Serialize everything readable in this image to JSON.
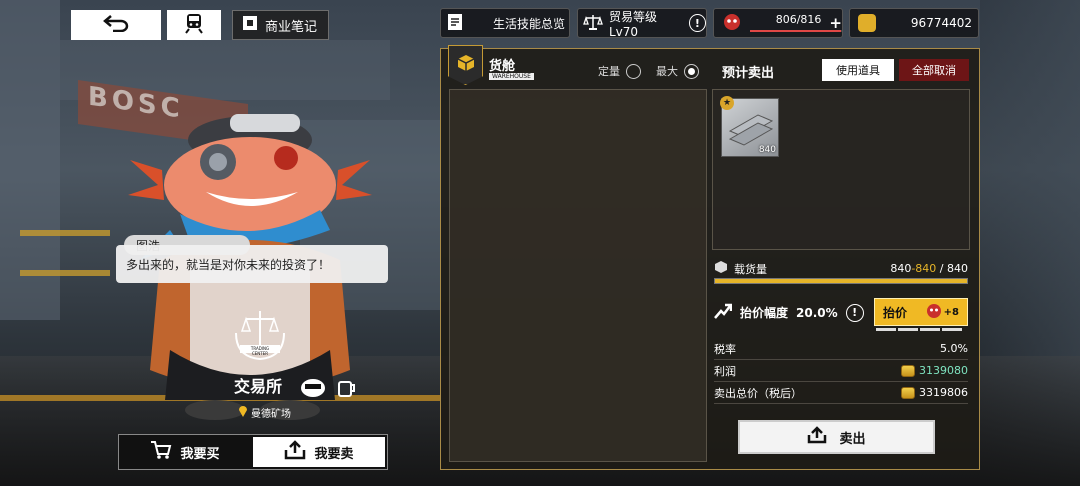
{
  "topbar": {
    "back_icon": "back-arrow-icon",
    "train_icon": "train-icon",
    "notes_label": "商业笔记",
    "life_skills_label": "生活技能总览",
    "trade_level_label": "贸易等级Lv70",
    "stamina_text": "806/816",
    "stamina_fraction": 0.988,
    "coins": "96774402"
  },
  "npc": {
    "name": "图浩",
    "dialogue": "多出来的，就当是对你未来的投资了！",
    "emblem_text": "TRADING CENTER",
    "store_title": "交易所",
    "location": "曼德矿场"
  },
  "mode_tabs": {
    "buy_label": "我要买",
    "sell_label": "我要卖"
  },
  "panel": {
    "cargo_title": "货舱",
    "cargo_sub": "WAREHOUSE",
    "radio_fixed": "定量",
    "radio_max": "最大",
    "preview_title": "预计卖出",
    "use_item_label": "使用道具",
    "cancel_all_label": "全部取消",
    "item": {
      "quantity": "840",
      "star": "★"
    },
    "capacity": {
      "label": "载货量",
      "current": "840",
      "highlight": "-840",
      "max": "/ 840",
      "fraction": 1.0
    },
    "markup": {
      "label": "抬价幅度",
      "value": "20.0%",
      "raise_label": "抬价",
      "raise_count": "+8"
    },
    "tax_label": "税率",
    "tax_value": "5.0%",
    "profit_label": "利润",
    "profit_value": "3139080",
    "total_label": "卖出总价（税后）",
    "total_value": "3319806",
    "sell_label": "卖出"
  },
  "colors": {
    "accent_gold": "#e6b529",
    "profit_green": "#7fe3c0",
    "cancel_red": "#6d1516"
  }
}
